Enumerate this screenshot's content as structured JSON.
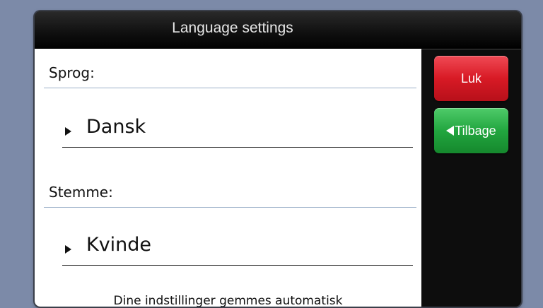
{
  "window": {
    "title": "Language settings"
  },
  "language": {
    "label": "Sprog:",
    "value": "Dansk"
  },
  "voice": {
    "label": "Stemme:",
    "value": "Kvinde"
  },
  "footer": {
    "note": "Dine indstillinger gemmes automatisk"
  },
  "sidebar": {
    "close_label": "Luk",
    "back_label": "Tilbage",
    "close_color": "#d81a25",
    "back_color": "#22a63f"
  },
  "icons": {
    "option_arrow": "play-triangle-icon",
    "back_arrow": "left-triangle-icon"
  }
}
